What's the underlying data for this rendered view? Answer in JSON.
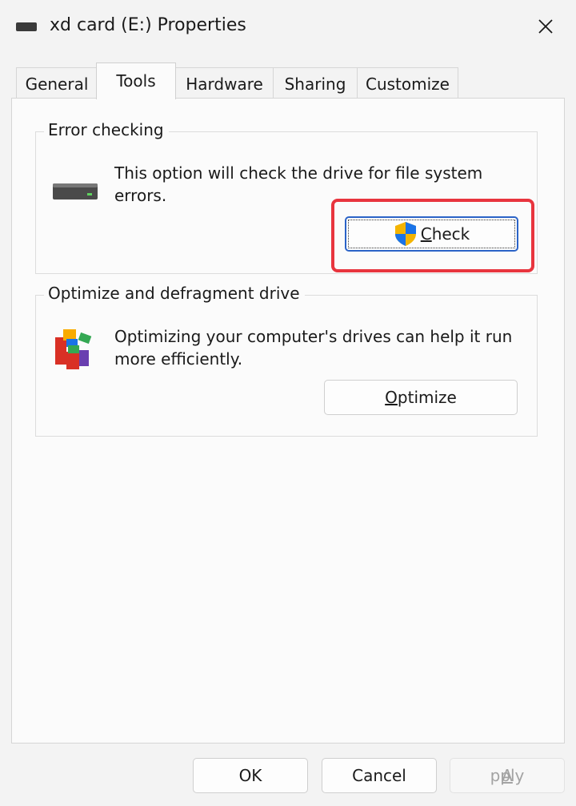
{
  "window": {
    "title": "xd card (E:) Properties",
    "close_icon": "close-icon"
  },
  "tabs": [
    {
      "label": "General",
      "active": false
    },
    {
      "label": "Tools",
      "active": true
    },
    {
      "label": "Hardware",
      "active": false
    },
    {
      "label": "Sharing",
      "active": false
    },
    {
      "label": "Customize",
      "active": false
    }
  ],
  "error_checking": {
    "group_label": "Error checking",
    "description": "This option will check the drive for file system errors.",
    "icon": "drive-icon",
    "button": {
      "accel": "C",
      "rest": "heck",
      "icon": "uac-shield-icon"
    },
    "highlight_color": "#e8353e"
  },
  "optimize": {
    "group_label": "Optimize and defragment drive",
    "description": "Optimizing your computer's drives can help it run more efficiently.",
    "icon": "defrag-icon",
    "button": {
      "accel": "O",
      "rest": "ptimize"
    }
  },
  "footer": {
    "ok": "OK",
    "cancel": "Cancel",
    "apply": {
      "accel": "A",
      "rest": "pply",
      "enabled": false
    }
  }
}
